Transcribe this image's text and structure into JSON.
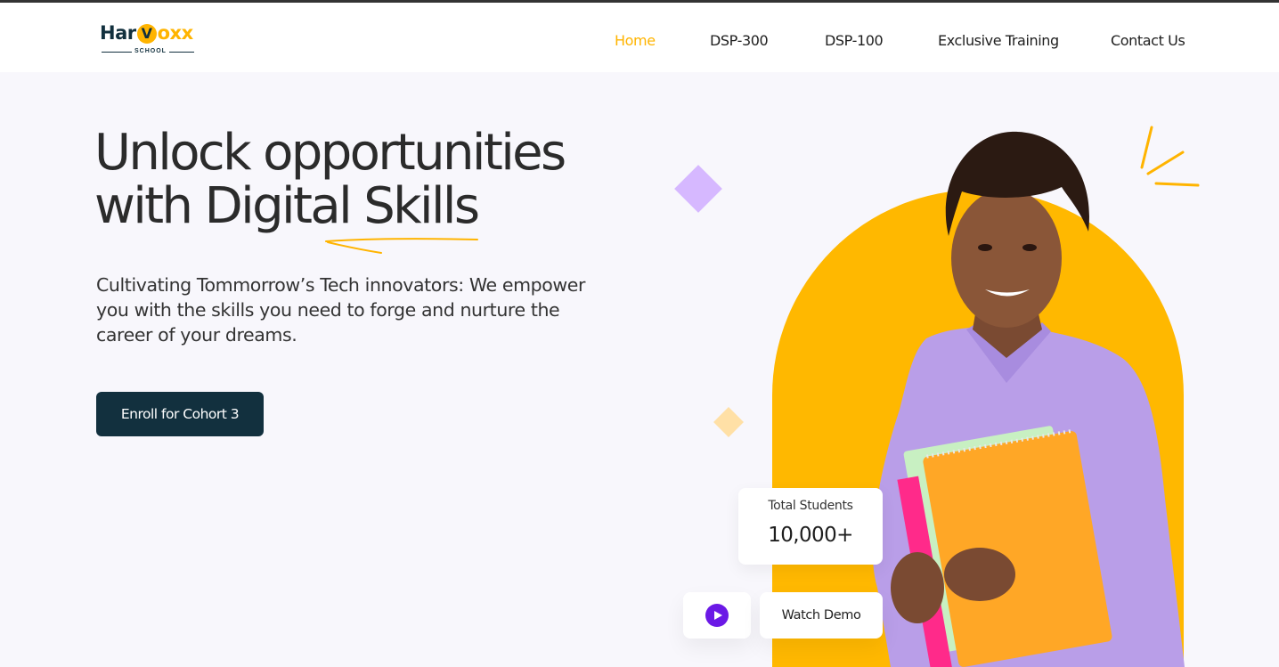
{
  "header": {
    "logo": {
      "prefix": "Har",
      "highlight": "V",
      "suffix": "oxx",
      "tagline": "SCHOOL"
    },
    "nav": [
      {
        "label": "Home",
        "active": true
      },
      {
        "label": "DSP-300",
        "active": false
      },
      {
        "label": "DSP-100",
        "active": false
      },
      {
        "label": "Exclusive Training",
        "active": false
      },
      {
        "label": "Contact Us",
        "active": false
      }
    ]
  },
  "hero": {
    "title_line1": "Unlock opportunities",
    "title_line2": "with Digital Skills",
    "subtitle": "Cultivating Tommorrow’s Tech innovators: We empower you with the skills you need to forge and nurture the career of your dreams.",
    "cta_label": "Enroll for Cohort 3"
  },
  "stats": {
    "label": "Total Students",
    "value": "10,000+"
  },
  "demo": {
    "label": "Watch Demo"
  },
  "colors": {
    "accent": "#ffb400",
    "primary": "#12303e",
    "play": "#6b19e6",
    "background": "#f8f7fc"
  },
  "icons": {
    "play": "play-icon",
    "sparkle": "sparkle-icon"
  }
}
